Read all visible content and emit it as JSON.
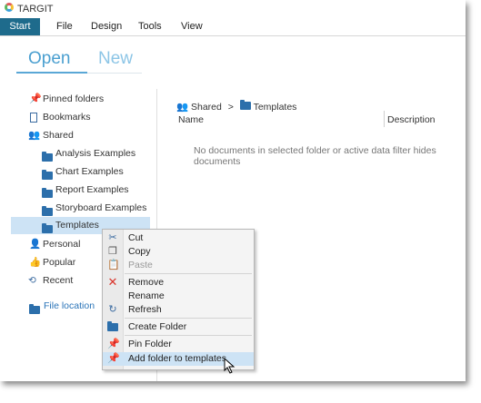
{
  "app": {
    "title": "TARGIT"
  },
  "menu": {
    "items": [
      "Start",
      "File",
      "Design",
      "Tools",
      "View"
    ]
  },
  "tabs": {
    "open": "Open",
    "new": "New"
  },
  "nav": {
    "pinned": "Pinned folders",
    "bookmarks": "Bookmarks",
    "shared": "Shared",
    "folders": [
      "Analysis Examples",
      "Chart Examples",
      "Report Examples",
      "Storyboard Examples",
      "Templates"
    ],
    "personal": "Personal",
    "popular": "Popular",
    "recent": "Recent",
    "file_location": "File location"
  },
  "main": {
    "breadcrumb_root": "Shared",
    "breadcrumb_sep": ">",
    "breadcrumb_current": "Templates",
    "col_name": "Name",
    "col_description": "Description",
    "empty_message": "No documents in selected folder or active data filter hides documents"
  },
  "context_menu": {
    "cut": "Cut",
    "copy": "Copy",
    "paste": "Paste",
    "remove": "Remove",
    "rename": "Rename",
    "refresh": "Refresh",
    "create_folder": "Create Folder",
    "pin_folder": "Pin Folder",
    "add_to_templates": "Add folder to templates"
  },
  "colors": {
    "accent": "#1e6b8c",
    "link": "#2a74b8",
    "selection": "#cde3f5",
    "folder": "#2c6fab"
  }
}
